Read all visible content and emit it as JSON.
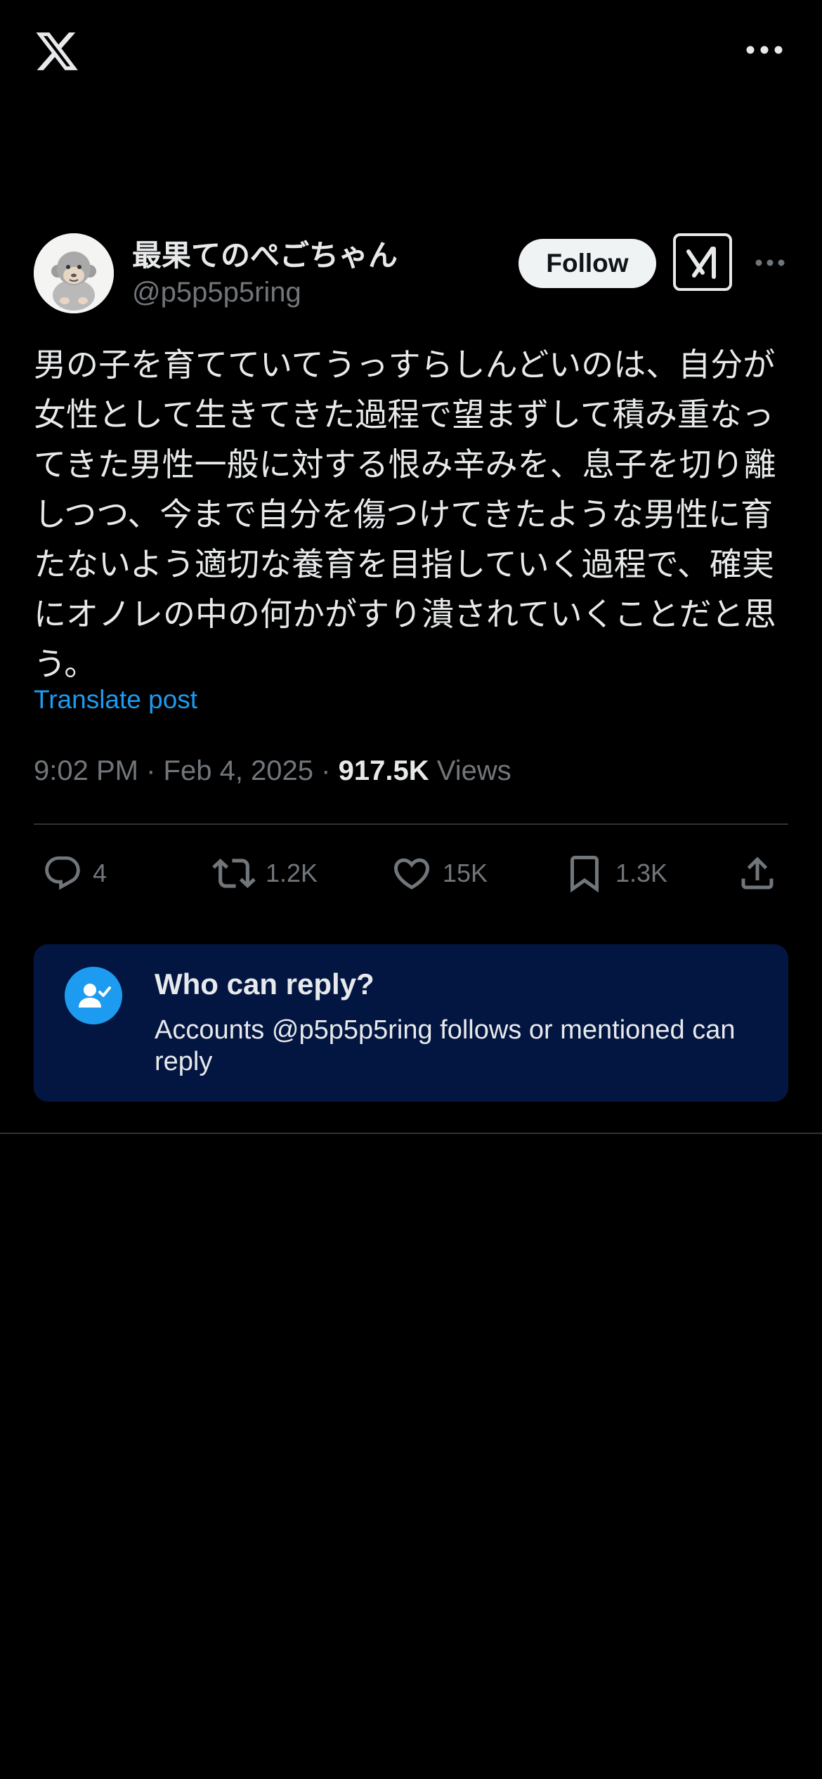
{
  "topbar": {
    "logo_icon": "x-logo-icon",
    "more_icon": "more-horizontal-icon"
  },
  "author": {
    "display_name": "最果てのぺごちゃん",
    "handle": "@p5p5p5ring",
    "avatar_icon": "gorilla-avatar",
    "follow_label": "Follow",
    "grok_icon": "grok-icon",
    "more_icon": "more-horizontal-icon"
  },
  "post": {
    "text": "男の子を育てていてうっすらしんどいのは、自分が女性として生きてきた過程で望まずして積み重なってきた男性一般に対する恨み辛みを、息子を切り離しつつ、今まで自分を傷つけてきたような男性に育たないよう適切な養育を目指していく過程で、確実にオノレの中の何かがすり潰されていくことだと思う。",
    "translate_label": "Translate post",
    "time": "9:02 PM",
    "separator": "·",
    "date": "Feb 4, 2025",
    "views_count": "917.5K",
    "views_label": "Views"
  },
  "actions": {
    "replies": "4",
    "reposts": "1.2K",
    "likes": "15K",
    "bookmarks": "1.3K",
    "icons": [
      "reply-icon",
      "repost-icon",
      "like-icon",
      "bookmark-icon",
      "share-icon"
    ]
  },
  "reply_settings": {
    "title": "Who can reply?",
    "description": "Accounts @p5p5p5ring follows or mentioned can reply",
    "icon": "person-check-icon"
  },
  "colors": {
    "background": "#000000",
    "text": "#e7e9ea",
    "secondary": "#71767b",
    "accent": "#1d9bf0",
    "card": "#031642"
  }
}
